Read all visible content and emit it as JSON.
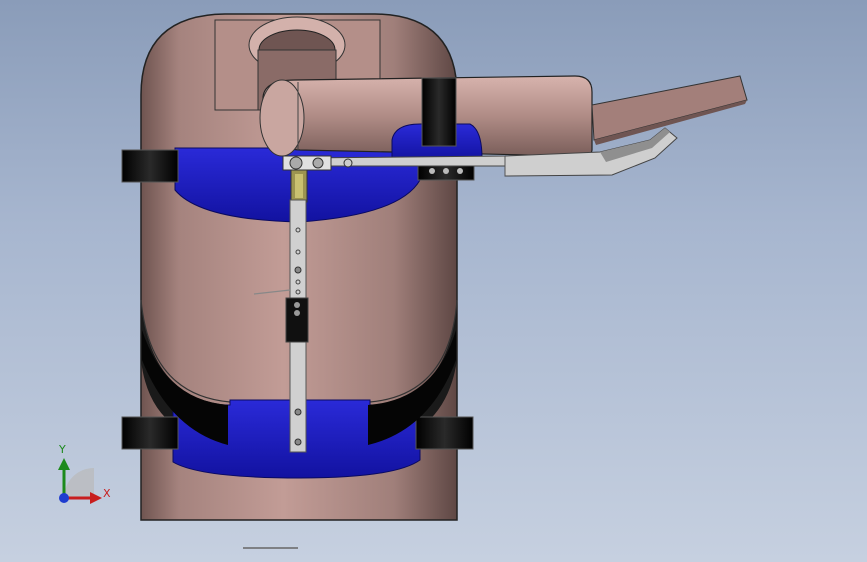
{
  "triad": {
    "y_label": "Y",
    "x_label": "X"
  },
  "colors": {
    "body": "#b08c86",
    "strap_blue": "#1c1cc4",
    "strap_black": "#0a0a0a",
    "metal": "#d6d6d6",
    "axis_x": "#c81e1e",
    "axis_y": "#1c8a1c",
    "axis_z": "#1e3ccf"
  }
}
